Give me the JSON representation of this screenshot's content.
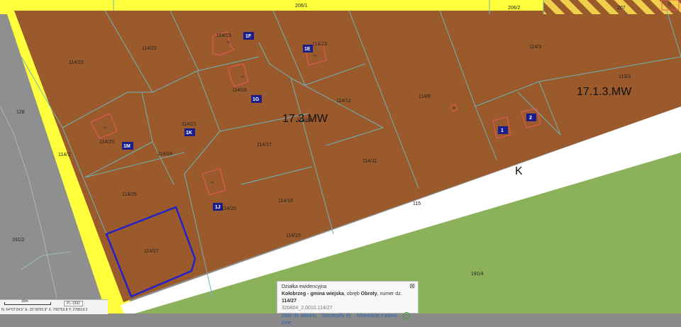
{
  "map": {
    "parcels": {
      "p206_1": "206/1",
      "p206_2": "206/2",
      "p207": "207",
      "p0": "0",
      "p114_23": "114/23",
      "p114_22": "114/22",
      "p114_15": "114/15",
      "p114_13": "114/13",
      "p114_3": "114/3",
      "p113_3": "113/3",
      "p114_16": "114/16",
      "p114_12": "114/12",
      "p114_6": "114/6",
      "p114_21": "114/21",
      "p114_14": "114/14",
      "p114_25": "114/25",
      "p114_24": "114/24",
      "p114_17": "114/17",
      "p114_11": "114/11",
      "p114_26": "114/26",
      "p114_18": "114/18",
      "p114_20": "114/20",
      "p114_19": "114/19",
      "p114_27": "114/27",
      "p128": "128",
      "p114_1": "114/1",
      "p191_2": "191/2",
      "p115": "115",
      "p191_4": "191/4"
    },
    "building_label": "m",
    "zones": {
      "mw_center": "17.3.MW",
      "mw_right": "17.1.3.MW",
      "road": "K"
    },
    "tags": [
      "1F",
      "1E",
      "1G",
      "1K",
      "1M",
      "1J",
      "1",
      "2"
    ],
    "colors": {
      "parcel_fill": "#9a5a2c",
      "parcel_line": "#6db4b8",
      "yellow": "#ffff3c",
      "road_white": "#ffffff",
      "green": "#8bb15a",
      "gray": "#8f8f8f",
      "building": "#e8585a",
      "tag_fill": "#1c1c8a",
      "selection": "#2222c8"
    }
  },
  "popup": {
    "title": "Działka ewidencyjna",
    "line1_a": "Kołobrzeg - gmina wiejska",
    "line1_b": ", obręb ",
    "line1_c": "Obroty",
    "line1_d": ", numer dz. ",
    "line1_e": "114/27",
    "line2": "320804_2.0010.114/27",
    "links": {
      "zoom": "Zbliż do obiektu",
      "details": "Szczegóły (I)",
      "plan": "Informacje z planu",
      "other": "Inne"
    },
    "close": "⊠"
  },
  "scalebar": {
    "distance": "30m",
    "projection": "PL-1992",
    "coords": "N: 54°07'24.5\"  E: 15°36'55.9\"   X: 700753.8   Y: 278913.2"
  }
}
